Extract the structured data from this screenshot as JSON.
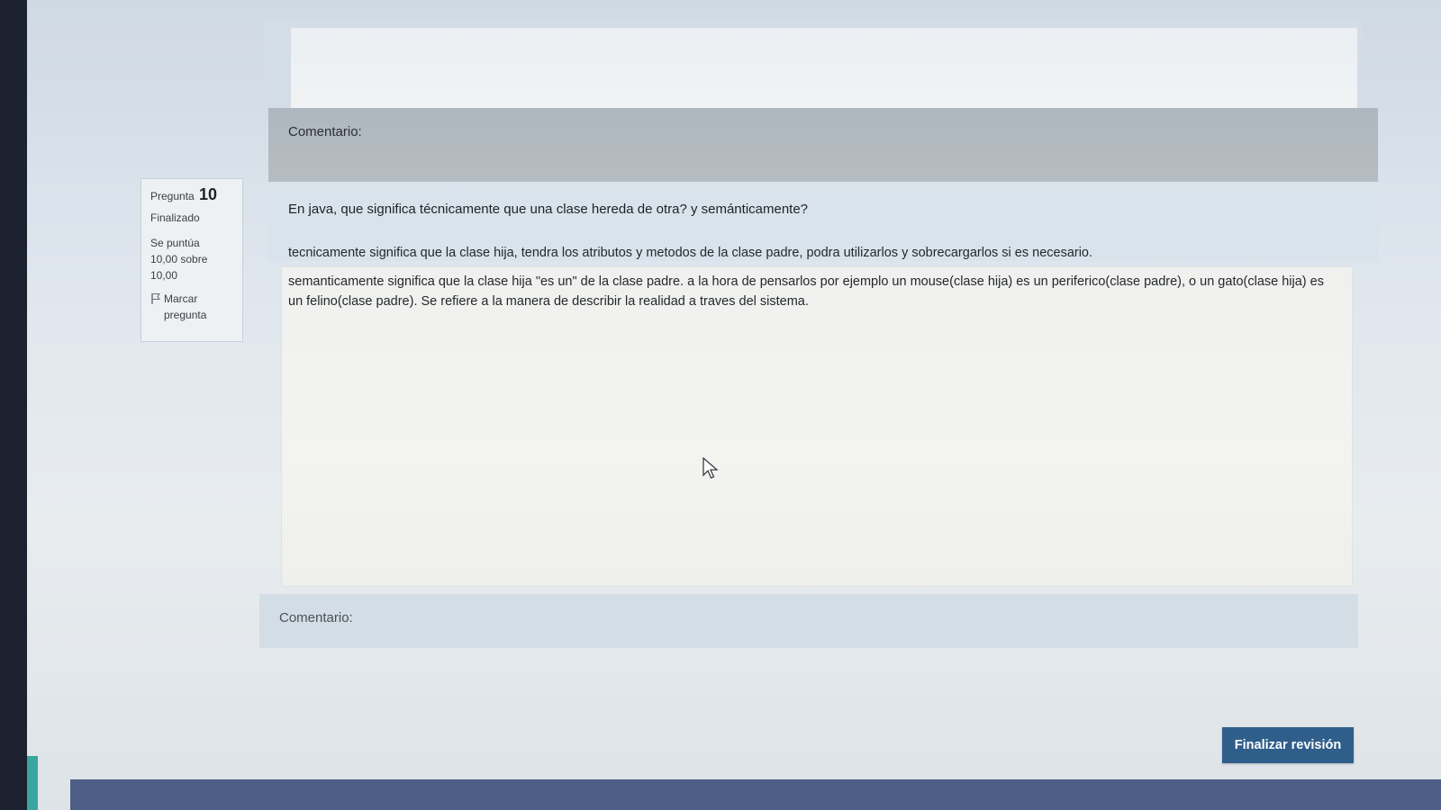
{
  "previous_question": {
    "comment_label": "Comentario:"
  },
  "question_info": {
    "question_prefix": "Pregunta",
    "question_number": "10",
    "state": "Finalizado",
    "grade_line1": "Se puntúa",
    "grade_line2": "10,00 sobre",
    "grade_line3": "10,00",
    "flag_label_line1": "Marcar",
    "flag_label_line2": "pregunta"
  },
  "question": {
    "text": "En java, que significa técnicamente que una clase hereda de otra? y semánticamente?"
  },
  "answer": {
    "paragraph1": "tecnicamente significa que la clase hija, tendra los atributos y metodos de la clase padre, podra utilizarlos y sobrecargarlos si es necesario.",
    "paragraph2": "semanticamente significa que la clase hija \"es un\" de la clase padre. a la hora de pensarlos por ejemplo un mouse(clase hija) es un periferico(clase padre), o un gato(clase hija) es un felino(clase padre). Se refiere a la manera de describir la realidad a traves del sistema."
  },
  "comment": {
    "label": "Comentario:"
  },
  "actions": {
    "finish_review": "Finalizar revisión"
  },
  "colors": {
    "accent": "#2f5e8a",
    "footer": "#4d5f86"
  }
}
